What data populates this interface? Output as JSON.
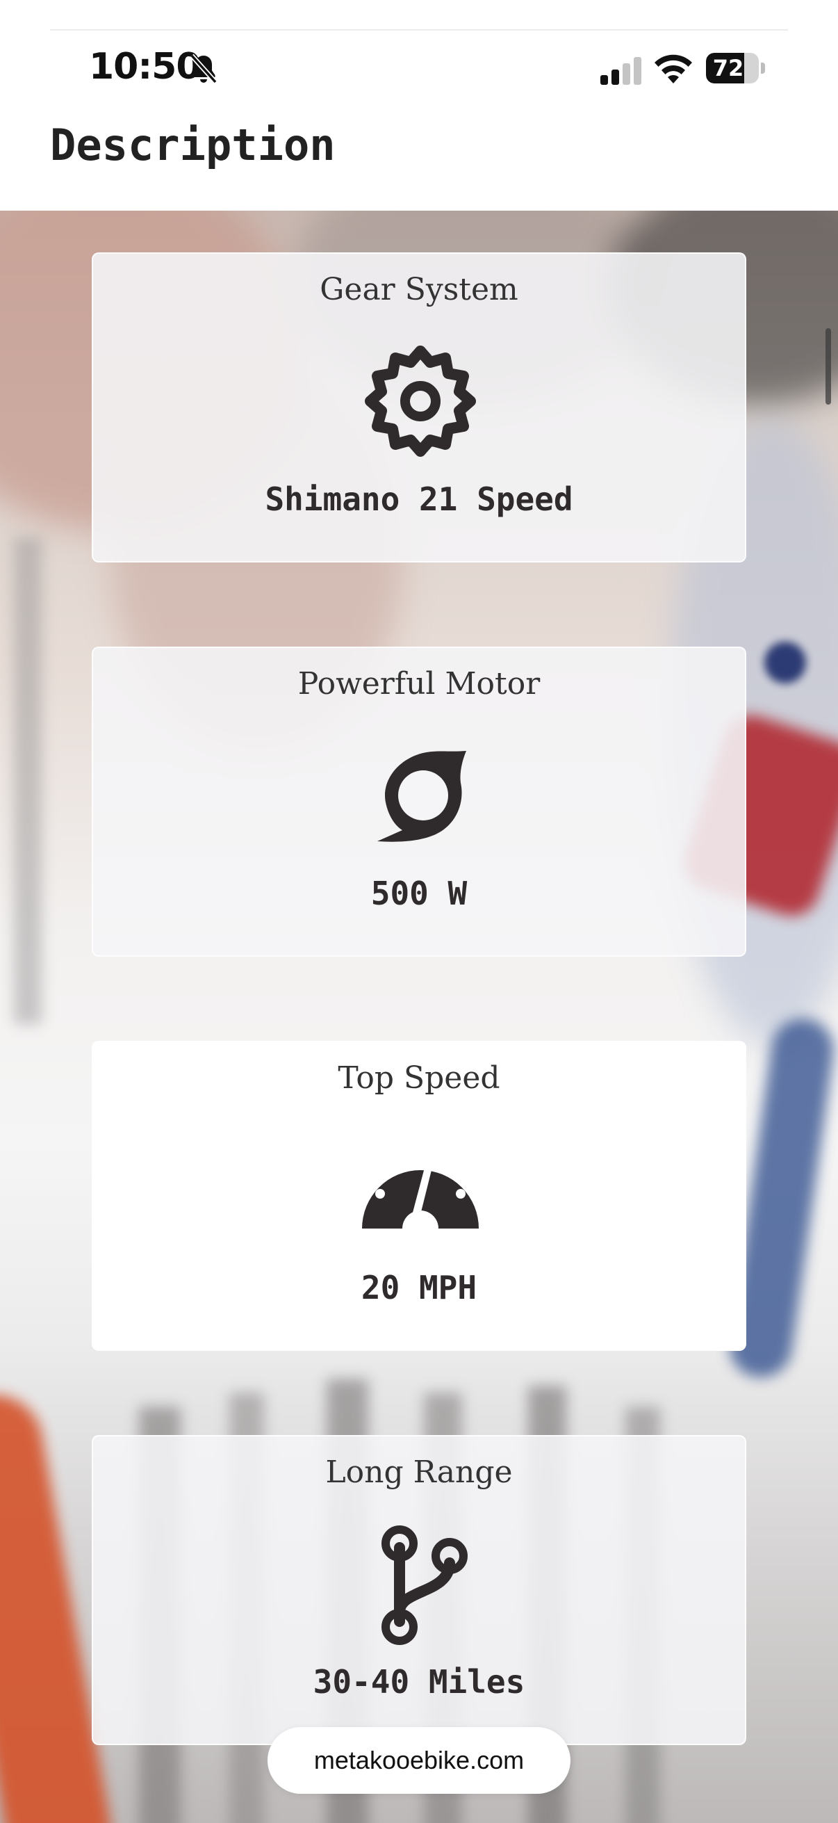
{
  "status_bar": {
    "time": "10:50",
    "battery_level": "72",
    "signal_bars_active": 2,
    "signal_bars_total": 4,
    "icons": [
      "bell-slash-icon",
      "cellular-signal-icon",
      "wifi-icon",
      "battery-icon"
    ]
  },
  "header": {
    "title": "Description"
  },
  "cards": [
    {
      "title": "Gear System",
      "value": "Shimano 21 Speed",
      "icon": "gear-icon"
    },
    {
      "title": "Powerful Motor",
      "value": "500 W",
      "icon": "motor-swirl-icon"
    },
    {
      "title": "Top Speed",
      "value": "20 MPH",
      "icon": "speedometer-icon"
    },
    {
      "title": "Long Range",
      "value": "30-40 Miles",
      "icon": "branch-route-icon"
    }
  ],
  "browser": {
    "url": "metakooebike.com"
  },
  "colors": {
    "text_dark": "#2f2a2b",
    "card_background": "#f5f5f7",
    "accent_red": "#c0262e",
    "accent_blue": "#2b4a8a"
  }
}
